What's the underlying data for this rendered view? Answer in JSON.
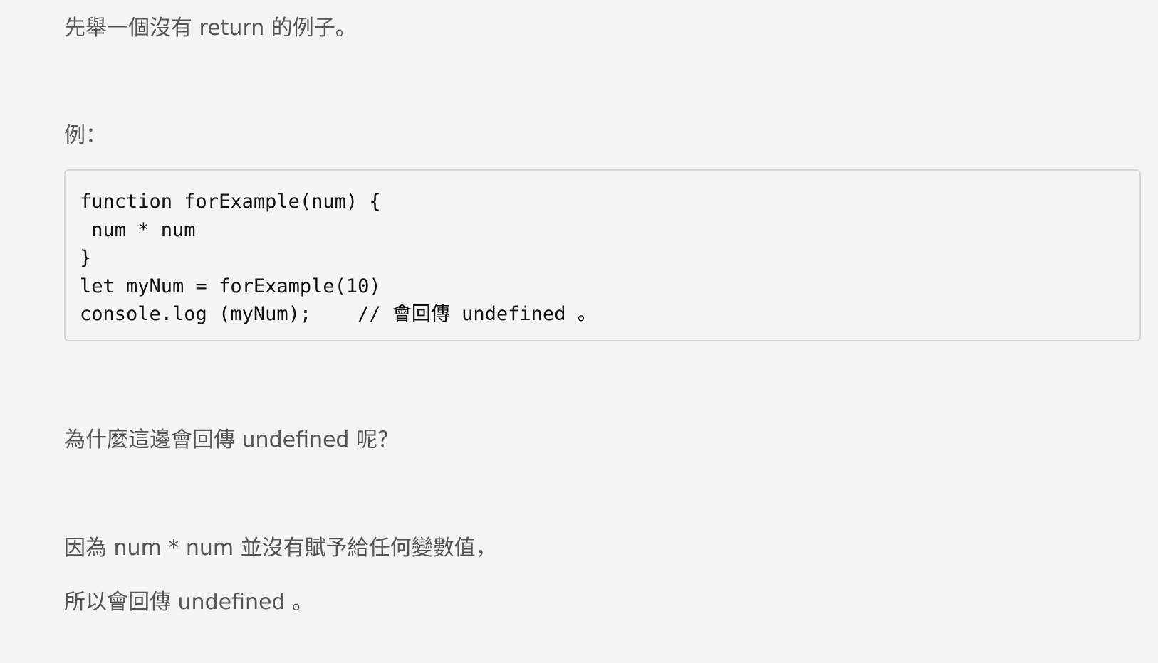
{
  "article": {
    "intro": "先舉一個沒有 return 的例子。",
    "example_label": "例：",
    "code_lines": [
      "function forExample(num) {",
      " num * num",
      "}",
      "let myNum = forExample(10)",
      "console.log (myNum);    // 會回傳 undefined 。"
    ],
    "question": "為什麼這邊會回傳 undefined 呢？",
    "answer_line_1": "因為 num * num 並沒有賦予給任何變數值，",
    "answer_line_2": "所以會回傳 undefined 。"
  },
  "colors": {
    "page_background": "#f4f4f4",
    "body_text": "#555555",
    "code_text": "#111111",
    "code_border": "#d6d6d6"
  }
}
